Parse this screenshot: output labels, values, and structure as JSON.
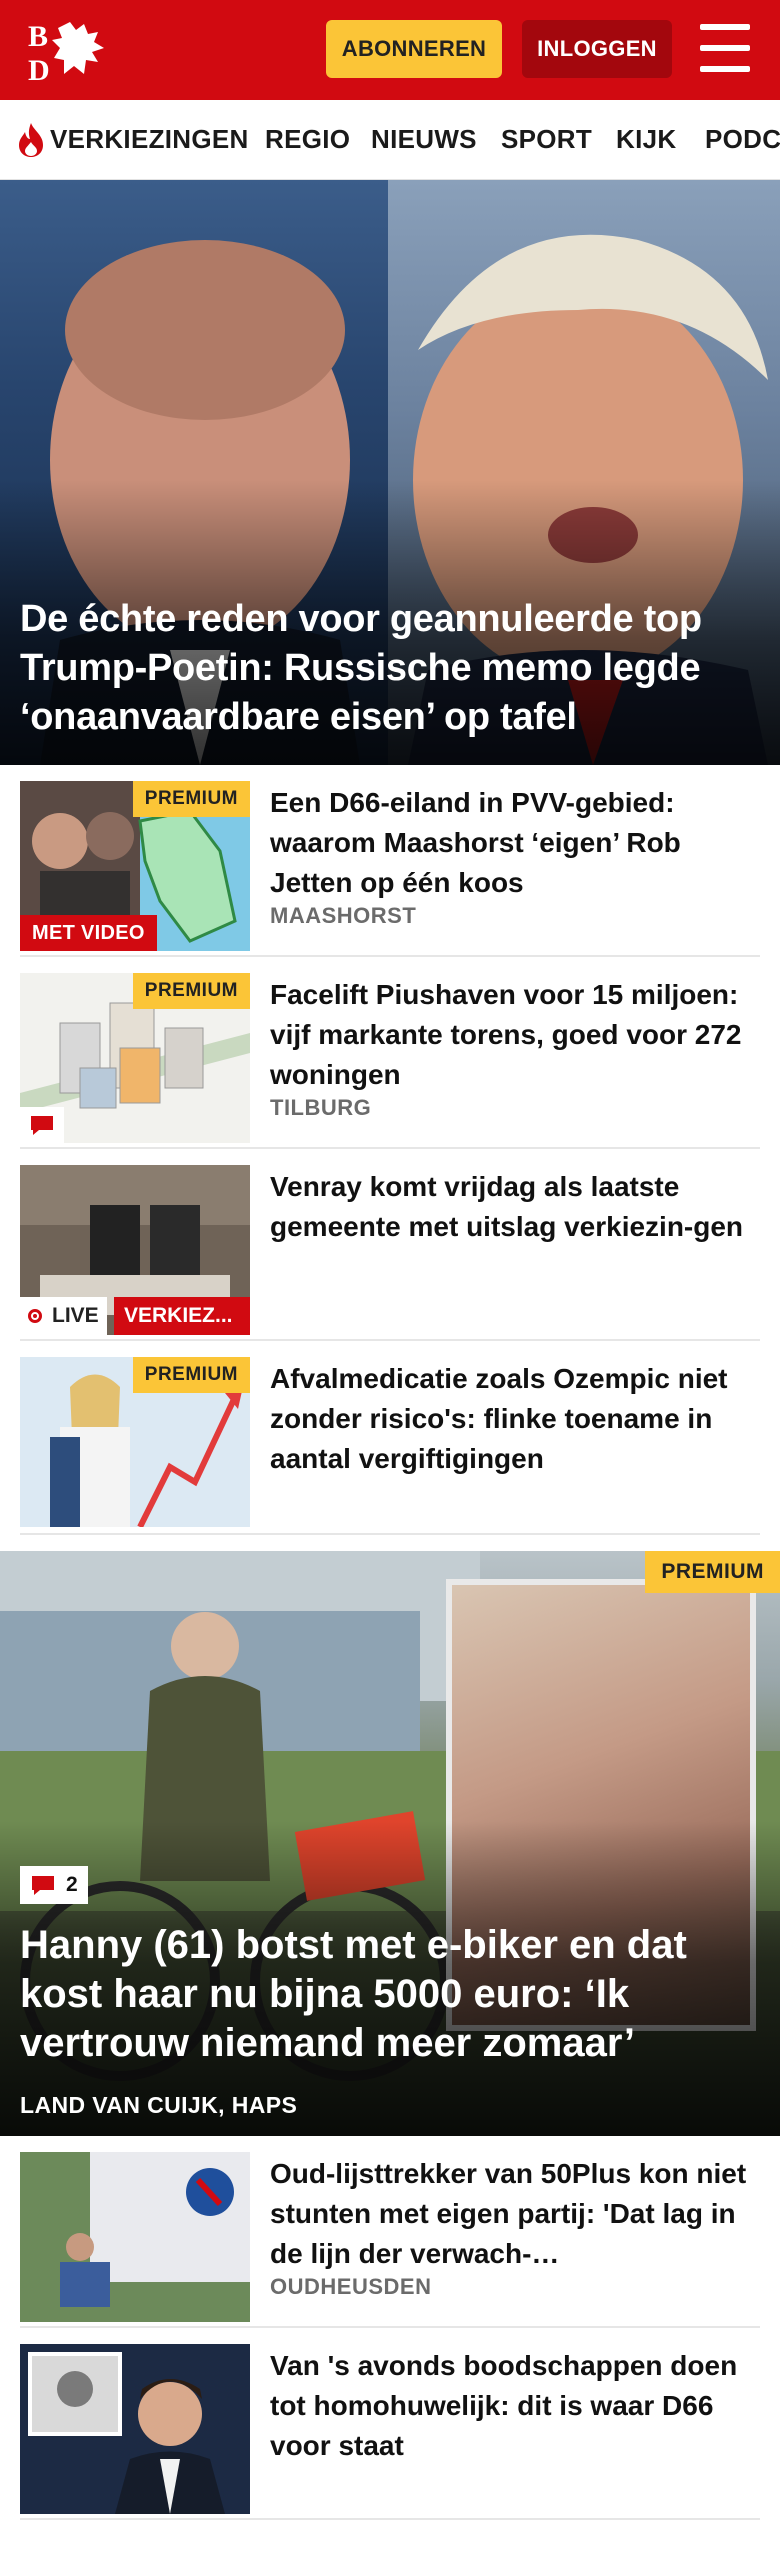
{
  "header": {
    "logo_icon": "bd-dragon-logo",
    "logo_text": "BD",
    "subscribe_label": "ABONNEREN",
    "login_label": "INLOGGEN",
    "menu_icon": "hamburger-menu-icon",
    "brand_color": "#d10a11",
    "subscribe_color": "#fbc537"
  },
  "nav": {
    "items": [
      {
        "label": "VERKIEZINGEN",
        "icon": "flame-icon"
      },
      {
        "label": "REGIO"
      },
      {
        "label": "NIEUWS"
      },
      {
        "label": "SPORT"
      },
      {
        "label": "KIJK"
      },
      {
        "label": "PODC"
      }
    ]
  },
  "hero": {
    "title": "De échte reden voor geannuleerde top Trump-Poetin: Russische memo legde ‘onaanvaardbare eisen’ op tafel"
  },
  "articles": [
    {
      "title": "Een D66-eiland in PVV-gebied: waarom Maashorst ‘eigen’ Rob Jetten op één koos",
      "kicker": "MAASHORST",
      "premium": "PREMIUM",
      "video": "MET VIDEO"
    },
    {
      "title": "Facelift Piushaven voor 15 miljoen: vijf markante torens, goed voor 272 woningen",
      "kicker": "TILBURG",
      "premium": "PREMIUM",
      "comment_icon": "comment-icon"
    },
    {
      "title": "Venray komt vrijdag als laatste gemeente met uitslag verkiezin-gen",
      "live": "LIVE",
      "tag": "VERKIEZ..."
    },
    {
      "title": "Afvalmedicatie zoals Ozempic niet zonder risico's: flinke toename in aantal vergiftigingen",
      "premium": "PREMIUM"
    }
  ],
  "big_story": {
    "premium": "PREMIUM",
    "comments": "2",
    "title": "Hanny (61) botst met e-biker en dat kost haar nu bijna 5000 euro: ‘Ik vertrouw niemand meer zomaar’",
    "kicker": "LAND VAN CUIJK, HAPS"
  },
  "articles2": [
    {
      "title": "Oud-lijsttrekker van 50Plus kon niet stunten met eigen partij: 'Dat lag in de lijn der verwach-…",
      "kicker": "OUDHEUSDEN"
    },
    {
      "title": "Van 's avonds boodschappen doen tot homohuwelijk: dit is waar D66 voor staat"
    }
  ]
}
